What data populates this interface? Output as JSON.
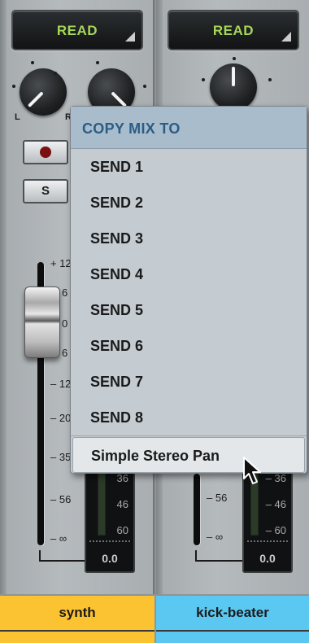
{
  "strips": [
    {
      "automation_mode": "READ",
      "pan_label_left": "L",
      "pan_label_right": "R",
      "record_label": "",
      "solo_label": "S",
      "fader_scale": [
        "+ 12",
        "6",
        "0",
        "6",
        "– 12",
        "– 20",
        "– 35",
        "– 56",
        "– ∞"
      ],
      "name": "synth",
      "color": "#fbc232"
    },
    {
      "automation_mode": "READ",
      "meter_scale": [
        "– 36",
        "– 46",
        "– 60"
      ],
      "fader_scale": [
        "– 56",
        "– ∞"
      ],
      "meter_value": "0.0",
      "name": "kick-beater",
      "color": "#5bc8f2"
    }
  ],
  "strip1_meter_scale": [
    "36",
    "46",
    "60"
  ],
  "strip1_meter_value": "0.0",
  "context_menu": {
    "title": "COPY MIX TO",
    "items": [
      "SEND 1",
      "SEND 2",
      "SEND 3",
      "SEND 4",
      "SEND 5",
      "SEND 6",
      "SEND 7",
      "SEND 8"
    ],
    "highlighted_item": "Simple Stereo Pan"
  },
  "colors": {
    "automation_text": "#a6d65a",
    "menu_title": "#2a5d86",
    "menu_bg": "#c4cbd1"
  }
}
